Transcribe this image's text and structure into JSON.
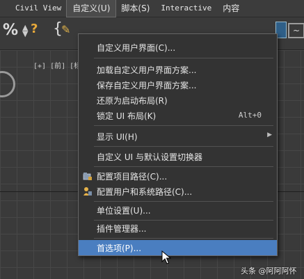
{
  "menubar": {
    "items": [
      "Civil View",
      "自定义(U)",
      "脚本(S)",
      "Interactive",
      "内容"
    ],
    "active_index": 1
  },
  "toolbar": {
    "percent_label": "%",
    "spinner_label": "?",
    "brace_label": "{",
    "wave_label": "~"
  },
  "viewport": {
    "label": "[+] [前] [标"
  },
  "dropdown": {
    "items": [
      {
        "label": "自定义用户界面(C)...",
        "shortcut": "",
        "submenu": false,
        "icon": ""
      },
      {
        "label": "加载自定义用户界面方案...",
        "shortcut": "",
        "submenu": false,
        "icon": ""
      },
      {
        "label": "保存自定义用户界面方案...",
        "shortcut": "",
        "submenu": false,
        "icon": ""
      },
      {
        "label": "还原为启动布局(R)",
        "shortcut": "",
        "submenu": false,
        "icon": ""
      },
      {
        "label": "锁定 UI 布局(K)",
        "shortcut": "Alt+0",
        "submenu": false,
        "icon": ""
      },
      {
        "label": "显示 UI(H)",
        "shortcut": "",
        "submenu": true,
        "icon": ""
      },
      {
        "label": "自定义 UI 与默认设置切换器",
        "shortcut": "",
        "submenu": false,
        "icon": ""
      },
      {
        "label": "配置项目路径(C)...",
        "shortcut": "",
        "submenu": false,
        "icon": "folder-icon"
      },
      {
        "label": "配置用户和系统路径(C)...",
        "shortcut": "",
        "submenu": false,
        "icon": "user-folder-icon"
      },
      {
        "label": "单位设置(U)...",
        "shortcut": "",
        "submenu": false,
        "icon": ""
      },
      {
        "label": "插件管理器...",
        "shortcut": "",
        "submenu": false,
        "icon": ""
      },
      {
        "label": "首选项(P)...",
        "shortcut": "",
        "submenu": false,
        "icon": ""
      }
    ],
    "highlighted_index": 11,
    "highlight_color": "#4a7ec0"
  },
  "watermark": {
    "text": "头条 @阿阿阿怀"
  }
}
